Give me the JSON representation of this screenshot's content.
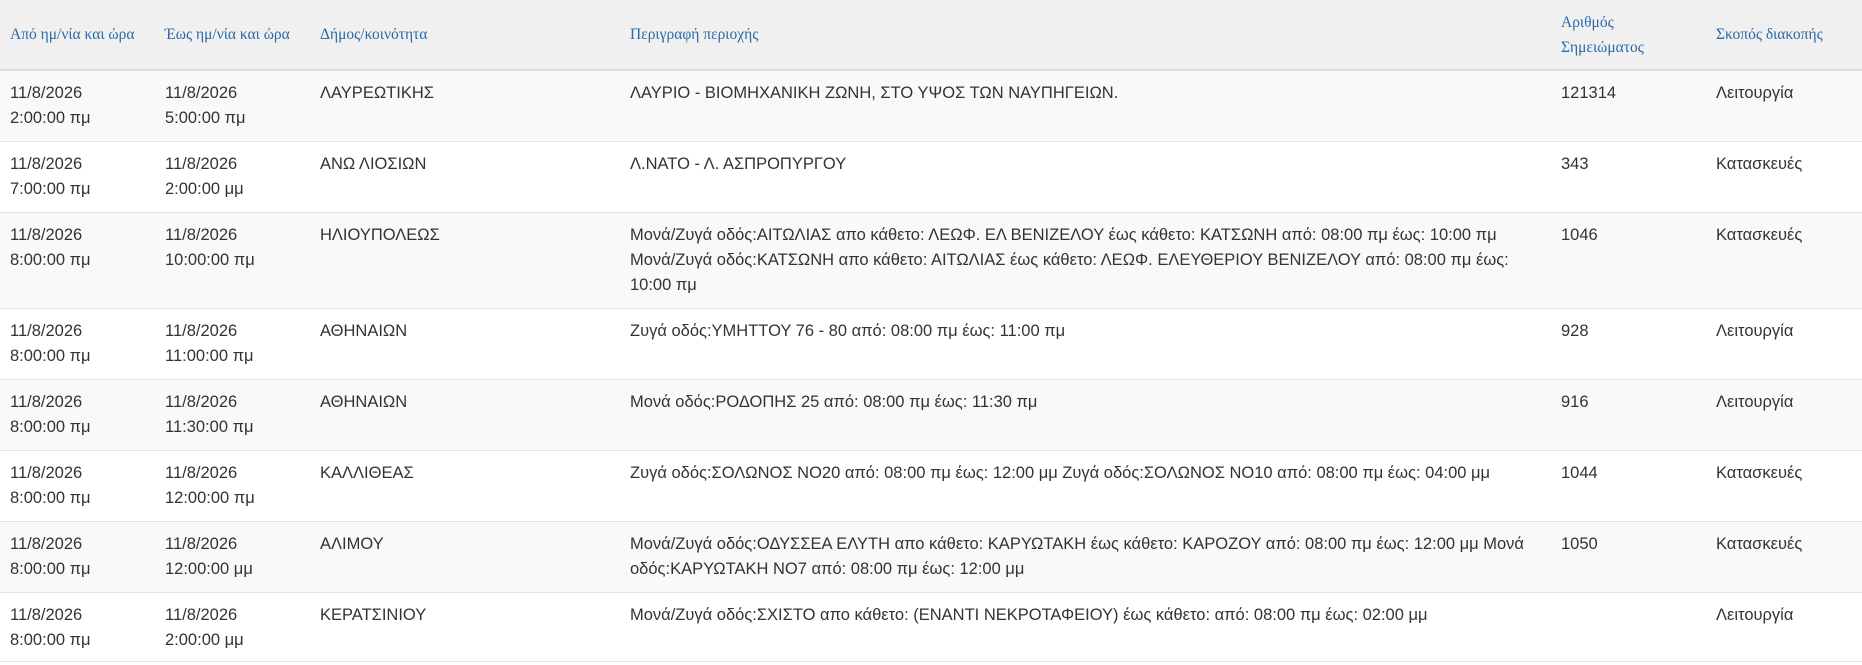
{
  "table": {
    "headers": {
      "from": "Από ημ/νία και ώρα",
      "to": "Έως ημ/νία και ώρα",
      "municipality": "Δήμος/κοινότητα",
      "description": "Περιγραφή περιοχής",
      "number": "Αριθμός Σημειώματος",
      "purpose": "Σκοπός διακοπής"
    },
    "rows": [
      {
        "from_date": "11/8/2026",
        "from_time": "2:00:00 πμ",
        "to_date": "11/8/2026",
        "to_time": "5:00:00 πμ",
        "municipality": "ΛΑΥΡΕΩΤΙΚΗΣ",
        "description": "ΛΑΥΡΙΟ - ΒΙΟΜΗΧΑΝΙΚΗ ΖΩΝΗ, ΣΤΟ ΥΨΟΣ ΤΩΝ ΝΑΥΠΗΓΕΙΩΝ.",
        "number": "121314",
        "purpose": "Λειτουργία"
      },
      {
        "from_date": "11/8/2026",
        "from_time": "7:00:00 πμ",
        "to_date": "11/8/2026",
        "to_time": "2:00:00 μμ",
        "municipality": "ΑΝΩ ΛΙΟΣΙΩΝ",
        "description": "Λ.ΝΑΤΟ - Λ. ΑΣΠΡΟΠΥΡΓΟΥ",
        "number": "343",
        "purpose": "Κατασκευές"
      },
      {
        "from_date": "11/8/2026",
        "from_time": "8:00:00 πμ",
        "to_date": "11/8/2026",
        "to_time": "10:00:00 πμ",
        "municipality": "ΗΛΙΟΥΠΟΛΕΩΣ",
        "description": "Μονά/Ζυγά οδός:ΑΙΤΩΛΙΑΣ απο κάθετο: ΛΕΩΦ. ΕΛ ΒΕΝΙΖΕΛΟΥ έως κάθετο: ΚΑΤΣΩΝΗ από: 08:00 πμ έως: 10:00 πμ Μονά/Ζυγά οδός:ΚΑΤΣΩΝΗ απο κάθετο: ΑΙΤΩΛΙΑΣ έως κάθετο: ΛΕΩΦ. ΕΛΕΥΘΕΡΙΟΥ ΒΕΝΙΖΕΛΟΥ από: 08:00 πμ έως: 10:00 πμ",
        "number": "1046",
        "purpose": "Κατασκευές"
      },
      {
        "from_date": "11/8/2026",
        "from_time": "8:00:00 πμ",
        "to_date": "11/8/2026",
        "to_time": "11:00:00 πμ",
        "municipality": "ΑΘΗΝΑΙΩΝ",
        "description": "Ζυγά οδός:ΥΜΗΤΤΟΥ 76 - 80 από: 08:00 πμ έως: 11:00 πμ",
        "number": "928",
        "purpose": "Λειτουργία"
      },
      {
        "from_date": "11/8/2026",
        "from_time": "8:00:00 πμ",
        "to_date": "11/8/2026",
        "to_time": "11:30:00 πμ",
        "municipality": "ΑΘΗΝΑΙΩΝ",
        "description": "Μονά οδός:ΡΟΔΟΠΗΣ 25 από: 08:00 πμ έως: 11:30 πμ",
        "number": "916",
        "purpose": "Λειτουργία"
      },
      {
        "from_date": "11/8/2026",
        "from_time": "8:00:00 πμ",
        "to_date": "11/8/2026",
        "to_time": "12:00:00 πμ",
        "municipality": "ΚΑΛΛΙΘΕΑΣ",
        "description": "Ζυγά οδός:ΣΟΛΩΝΟΣ ΝΟ20 από: 08:00 πμ έως: 12:00 μμ Ζυγά οδός:ΣΟΛΩΝΟΣ ΝΟ10 από: 08:00 πμ έως: 04:00 μμ",
        "number": "1044",
        "purpose": "Κατασκευές"
      },
      {
        "from_date": "11/8/2026",
        "from_time": "8:00:00 πμ",
        "to_date": "11/8/2026",
        "to_time": "12:00:00 μμ",
        "municipality": "ΑΛΙΜΟΥ",
        "description": "Μονά/Ζυγά οδός:ΟΔΥΣΣΕΑ ΕΛΥΤΗ απο κάθετο: ΚΑΡΥΩΤΑΚΗ έως κάθετο: ΚΑΡΟΖΟΥ από: 08:00 πμ έως: 12:00 μμ Μονά οδός:ΚΑΡΥΩΤΑΚΗ ΝΟ7 από: 08:00 πμ έως: 12:00 μμ",
        "number": "1050",
        "purpose": "Κατασκευές"
      },
      {
        "from_date": "11/8/2026",
        "from_time": "8:00:00 πμ",
        "to_date": "11/8/2026",
        "to_time": "2:00:00 μμ",
        "municipality": "ΚΕΡΑΤΣΙΝΙΟΥ",
        "description": "Μονά/Ζυγά οδός:ΣΧΙΣΤΟ απο κάθετο: (ΕΝΑΝΤΙ ΝΕΚΡΟΤΑΦΕΙΟΥ) έως κάθετο: από: 08:00 πμ έως: 02:00 μμ",
        "number": "",
        "purpose": "Λειτουργία"
      }
    ]
  }
}
